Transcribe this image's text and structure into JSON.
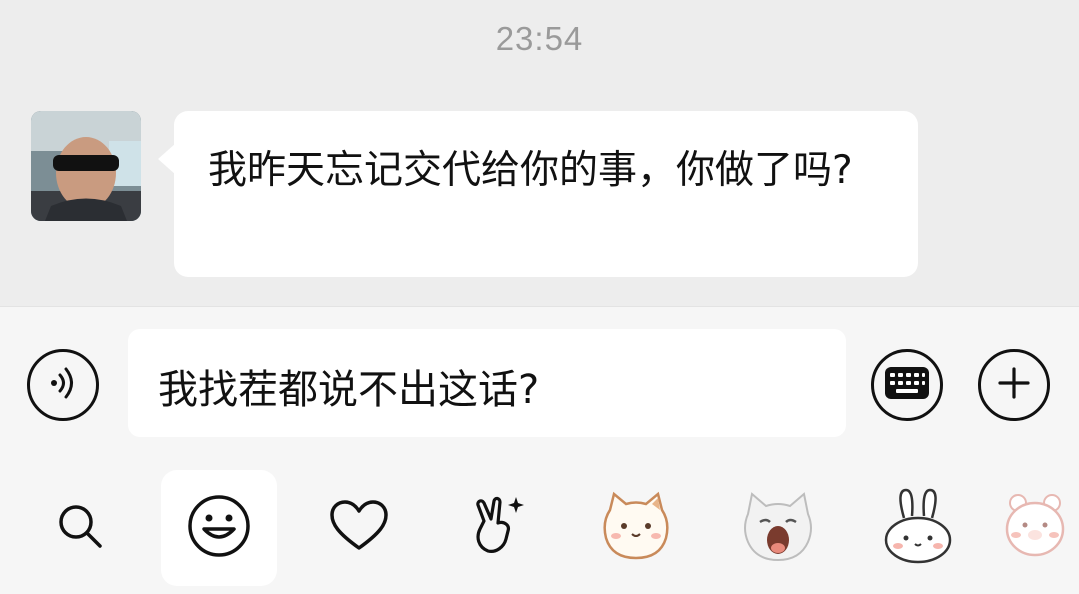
{
  "chat": {
    "timestamp": "23:54",
    "messages": [
      {
        "sender": "contact",
        "text": "我昨天忘记交代给你的事，你做了吗?"
      }
    ]
  },
  "composer": {
    "input_value": "我找茬都说不出这话?",
    "voice_icon": "voice-icon",
    "keyboard_icon": "keyboard-icon",
    "add_icon": "plus-icon"
  },
  "sticker_panel": {
    "tabs": [
      {
        "icon": "search-icon"
      },
      {
        "icon": "emoji-smile-icon",
        "active": true
      },
      {
        "icon": "heart-icon"
      },
      {
        "icon": "hand-gesture-icon"
      },
      {
        "icon": "cat-sticker-icon"
      },
      {
        "icon": "white-cat-sticker-icon"
      },
      {
        "icon": "bunny-sticker-icon"
      },
      {
        "icon": "bear-sticker-icon"
      }
    ]
  },
  "colors": {
    "chat_background": "#ededed",
    "bubble": "#ffffff",
    "panel_background": "#f6f6f6",
    "timestamp": "#9a9a9a"
  }
}
